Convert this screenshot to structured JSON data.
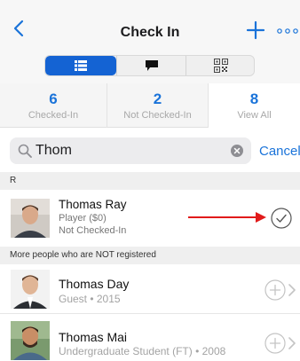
{
  "nav": {
    "title": "Check In",
    "back_icon": "chevron-left-icon",
    "add_icon": "plus-icon",
    "more_icon": "more-dots-icon"
  },
  "segments": [
    {
      "icon": "list-icon",
      "selected": true
    },
    {
      "icon": "chat-icon",
      "selected": false
    },
    {
      "icon": "qr-code-icon",
      "selected": false
    }
  ],
  "stats": [
    {
      "value": "6",
      "label": "Checked-In"
    },
    {
      "value": "2",
      "label": "Not Checked-In"
    },
    {
      "value": "8",
      "label": "View All"
    }
  ],
  "search": {
    "value": "Thom",
    "cancel_label": "Cancel"
  },
  "sections": {
    "registered_header": "R",
    "unregistered_header": "More people who are NOT registered"
  },
  "registered": [
    {
      "name": "Thomas Ray",
      "role": "Player ($0)",
      "status": "Not Checked-In"
    }
  ],
  "unregistered": [
    {
      "name": "Thomas Day",
      "detail": "Guest • 2015"
    },
    {
      "name": "Thomas Mai",
      "detail": "Undergraduate Student (FT) • 2008"
    }
  ],
  "colors": {
    "accent": "#1a73d9",
    "segment_active": "#1463d3",
    "annotation_arrow": "#e11b1b"
  }
}
